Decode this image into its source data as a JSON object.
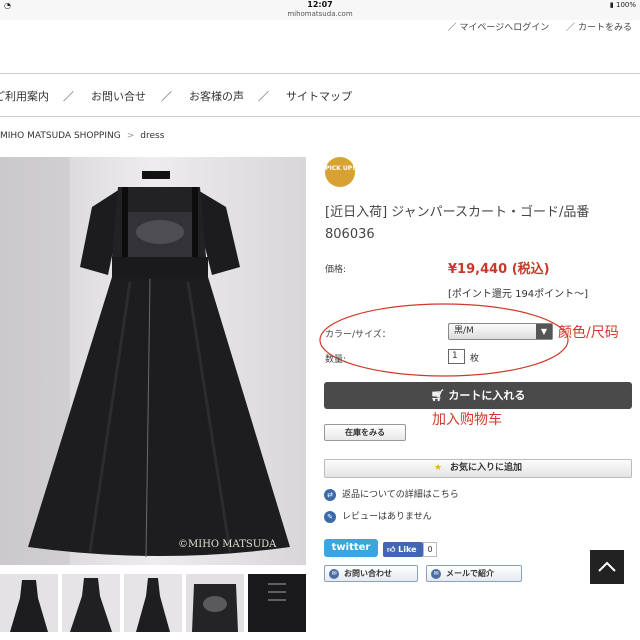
{
  "status_bar": {
    "time": "12:07",
    "url": "mihomatsuda.com",
    "battery": "100%"
  },
  "top_links": {
    "mypage": "／ マイページへログイン",
    "cart": "／ カートをみる"
  },
  "nav": {
    "items": [
      "ご利用案内",
      "お問い合せ",
      "お客様の声",
      "サイトマップ"
    ],
    "separator": "／"
  },
  "breadcrumb": {
    "shop": "MIHO MATSUDA SHOPPING",
    "category": "dress",
    "chevron": ">"
  },
  "product": {
    "badge": "PICK UP!",
    "title": "[近日入荷] ジャンパースカート・ゴード/品番 806036",
    "price_label": "価格:",
    "price": "¥19,440 (税込)",
    "points": "[ポイント還元 194ポイント〜]",
    "option_label": "カラー/サイズ：",
    "option_value": "黒/M",
    "qty_label": "数量:",
    "qty_value": "1",
    "qty_unit": "枚",
    "photo_watermark": "©MIHO MATSUDA"
  },
  "annotations": {
    "color_size": "颜色/尺码",
    "add_cart": "加入购物车"
  },
  "buttons": {
    "add_to_cart": "カートに入れる",
    "stock": "在庫をみる",
    "favorite": "お気に入りに追加",
    "returns": "返品についての詳細はこちら",
    "reviews": "レビューはありません",
    "twitter": "twitter",
    "fb_like": "Like",
    "fb_count": "0",
    "inquiry": "お問い合わせ",
    "mail": "メールで紹介"
  },
  "colors": {
    "price_red": "#c53b2a",
    "badge_gold": "#d7a233",
    "cart_btn": "#4a4a4a",
    "annotation_red": "#d03a2a"
  }
}
